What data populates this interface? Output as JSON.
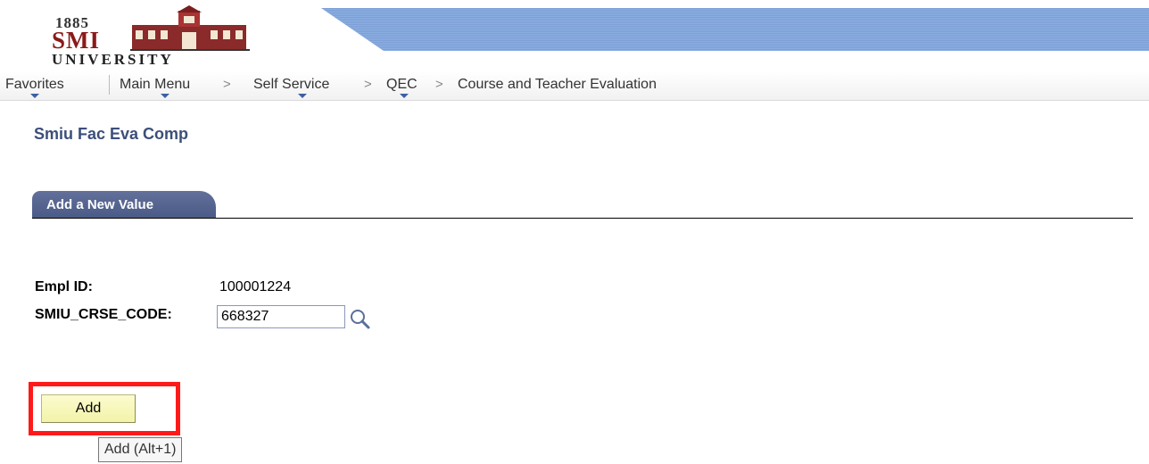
{
  "logo": {
    "year": "1885",
    "name": "SMI",
    "subtitle": "UNIVERSITY"
  },
  "nav": {
    "favorites": "Favorites",
    "main_menu": "Main Menu",
    "self_service": "Self Service",
    "qec": "QEC",
    "course_eval": "Course and Teacher Evaluation",
    "separator": ">"
  },
  "page": {
    "title": "Smiu Fac Eva Comp"
  },
  "tab": {
    "label": "Add a New Value"
  },
  "form": {
    "empl_id_label": "Empl ID:",
    "empl_id_value": "100001224",
    "course_code_label": "SMIU_CRSE_CODE:",
    "course_code_value": "668327"
  },
  "actions": {
    "add_label": "Add",
    "add_tooltip": "Add (Alt+1)"
  },
  "colors": {
    "tab_bg": "#55648f",
    "title": "#3c4f7a",
    "add_button_bg": "#f6f6b6",
    "highlight": "#ff1a1a",
    "banner": "#7d9fd6"
  },
  "icons": {
    "lookup": "magnifier-icon",
    "nav_dropdown": "triangle-down-icon"
  }
}
